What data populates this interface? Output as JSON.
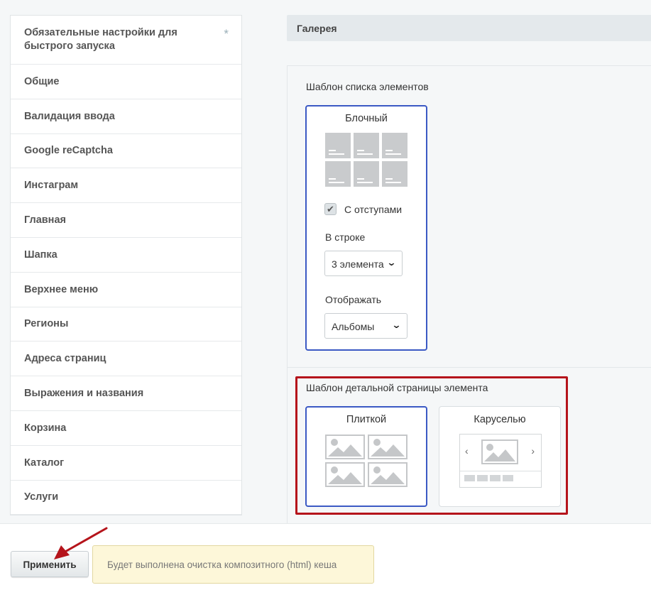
{
  "sidebar": {
    "items": [
      {
        "label": "Обязательные настройки для быстрого запуска",
        "starred": true
      },
      {
        "label": "Общие"
      },
      {
        "label": "Валидация ввода"
      },
      {
        "label": "Google reCaptcha"
      },
      {
        "label": "Инстаграм"
      },
      {
        "label": "Главная"
      },
      {
        "label": "Шапка"
      },
      {
        "label": "Верхнее меню"
      },
      {
        "label": "Регионы"
      },
      {
        "label": "Адреса страниц"
      },
      {
        "label": "Выражения и названия"
      },
      {
        "label": "Корзина"
      },
      {
        "label": "Каталог"
      },
      {
        "label": "Услуги"
      }
    ],
    "star_symbol": "*"
  },
  "section": {
    "title": "Галерея"
  },
  "list_template": {
    "label": "Шаблон списка элементов",
    "option_title": "Блочный",
    "checkbox_label": "С отступами",
    "checkbox_checked": true,
    "per_row_label": "В строке",
    "per_row_value": "3 элемента",
    "display_label": "Отображать",
    "display_value": "Альбомы"
  },
  "detail_template": {
    "label": "Шаблон детальной страницы элемента",
    "options": [
      {
        "title": "Плиткой",
        "selected": true
      },
      {
        "title": "Каруселью",
        "selected": false
      }
    ],
    "carousel_prev": "‹",
    "carousel_next": "›"
  },
  "footer": {
    "apply_label": "Применить",
    "notice_text": "Будет выполнена очистка композитного (html) кеша"
  },
  "colors": {
    "accent": "#3b59c4",
    "highlight": "#b5141b",
    "notice_bg": "#fdf7d9"
  }
}
